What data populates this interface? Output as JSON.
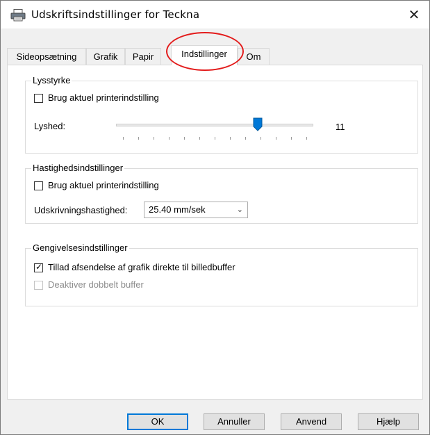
{
  "window": {
    "title": "Udskriftsindstillinger for Teckna",
    "close_glyph": "✕",
    "icon": "printer-icon"
  },
  "tabs": [
    {
      "label": "Sideopsætning"
    },
    {
      "label": "Grafik"
    },
    {
      "label": "Papir"
    },
    {
      "label": "Indstillinger",
      "active": true
    },
    {
      "label": "Om"
    }
  ],
  "brightness": {
    "group_label": "Lysstyrke",
    "checkbox_label": "Brug aktuel printerindstilling",
    "checkbox_checked": false,
    "slider_label": "Lyshed:",
    "slider_value": "11"
  },
  "speed": {
    "group_label": "Hastighedsindstillinger",
    "checkbox_label": "Brug aktuel printerindstilling",
    "checkbox_checked": false,
    "select_label": "Udskrivningshastighed:",
    "select_value": "25.40 mm/sek"
  },
  "rendering": {
    "group_label": "Gengivelsesindstillinger",
    "checkbox1_label": "Tillad afsendelse af grafik direkte til billedbuffer",
    "checkbox1_checked": true,
    "checkbox2_label": "Deaktiver dobbelt buffer",
    "checkbox2_checked": false,
    "checkbox2_disabled": true
  },
  "buttons": {
    "ok": "OK",
    "cancel": "Annuller",
    "apply": "Anvend",
    "help": "Hjælp"
  },
  "colors": {
    "annotation_red": "#e31b1b",
    "accent_blue": "#0078d7"
  }
}
